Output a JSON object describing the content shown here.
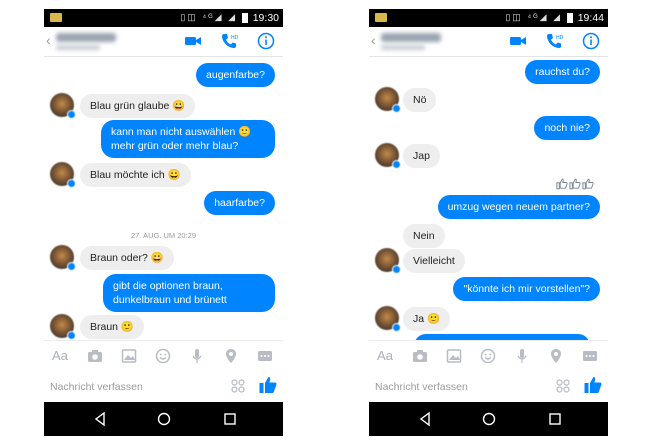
{
  "colors": {
    "accent": "#0084ff",
    "incoming": "#eeeeee",
    "statusbar": "#000000"
  },
  "composer": {
    "placeholder": "Nachricht verfassen"
  },
  "toolbar": {
    "text_label": "Aa"
  },
  "left": {
    "clock": "19:30",
    "messages": [
      {
        "text": "augenfarbe?"
      },
      {
        "text": "Blau grün glaube 😀"
      },
      {
        "line1": "kann man nicht auswählen 🙂",
        "line2": "mehr grün oder mehr blau?"
      },
      {
        "text": "Blau möchte ich 😀"
      },
      {
        "text": "haarfarbe?"
      },
      {
        "timestamp": "27. AUG. UM 20:29"
      },
      {
        "text": "Braun oder? 😀"
      },
      {
        "line1": "gibt die optionen braun,",
        "line2": "dunkelbraun und brünett"
      },
      {
        "text": "Braun 🙂"
      }
    ]
  },
  "right": {
    "clock": "19:44",
    "messages": [
      {
        "text": "rauchst du?"
      },
      {
        "text": "Nö"
      },
      {
        "text": "noch nie?"
      },
      {
        "text": "Jap"
      },
      {
        "text": "umzug wegen neuem partner?"
      },
      {
        "text": "Nein"
      },
      {
        "text": "Vielleicht"
      },
      {
        "text": "\"könnte ich mir vorstellen\"?"
      },
      {
        "text": "Ja 🙂"
      }
    ]
  }
}
